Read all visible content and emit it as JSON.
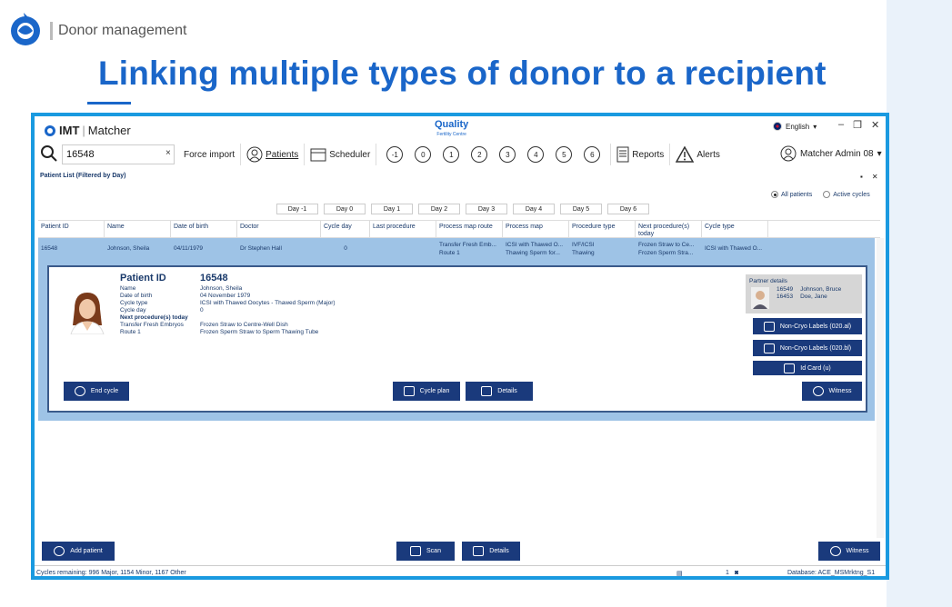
{
  "slide": {
    "section": "Donor management",
    "title": "Linking multiple types of donor to a recipient"
  },
  "app": {
    "brand_bold": "IMT",
    "brand_rest": "Matcher",
    "center_logo": "Quality",
    "center_logo_sub": "Fertility Centre",
    "language": "English",
    "search_value": "16548",
    "toolbar": {
      "force_import": "Force import",
      "patients": "Patients",
      "scheduler": "Scheduler",
      "day_circles": [
        "-1",
        "0",
        "1",
        "2",
        "3",
        "4",
        "5",
        "6"
      ],
      "reports": "Reports",
      "alerts": "Alerts"
    },
    "user": "Matcher Admin 08",
    "panel_title": "Patient List (Filtered by Day)",
    "radios": {
      "all": "All patients",
      "active": "Active cycles"
    },
    "day_tabs": [
      "Day -1",
      "Day 0",
      "Day 1",
      "Day 2",
      "Day 3",
      "Day 4",
      "Day 5",
      "Day 6"
    ],
    "columns": [
      "Patient ID",
      "Name",
      "Date of birth",
      "Doctor",
      "Cycle day",
      "Last procedure",
      "Process map route",
      "Process map",
      "Procedure type",
      "Next procedure(s) today",
      "Cycle type"
    ],
    "row": {
      "patient_id": "16548",
      "name": "Johnson, Sheila",
      "dob": "04/11/1979",
      "doctor": "Dr Stephen Hall",
      "cycle_day": "0",
      "last_procedure": "",
      "route_1": "Transfer Fresh Emb...",
      "route_2": "Route 1",
      "map_1": "ICSI with Thawed O...",
      "map_2": "Thawing Sperm for...",
      "type_1": "IVF/ICSI",
      "type_2": "Thawing",
      "next_1": "Frozen Straw to Ce...",
      "next_2": "Frozen Sperm Stra...",
      "cycle_type": "ICSI with Thawed O..."
    },
    "detail": {
      "pid_label": "Patient ID",
      "pid_value": "16548",
      "fields": [
        {
          "k": "Name",
          "v": "Johnson, Sheila"
        },
        {
          "k": "Date of birth",
          "v": "04 November 1979"
        },
        {
          "k": "Cycle type",
          "v": "ICSI with Thawed Oocytes - Thawed Sperm (Major)"
        },
        {
          "k": "Cycle day",
          "v": "0"
        }
      ],
      "next_heading": "Next procedure(s) today",
      "next_items": [
        {
          "k": "Transfer Fresh Embryos",
          "v": "Frozen Straw to Centre-Well Dish"
        },
        {
          "k": "Route 1",
          "v": "Frozen Sperm Straw to Sperm Thawing Tube"
        }
      ],
      "partner_title": "Partner details",
      "partners": [
        {
          "id": "16549",
          "name": "Johnson, Bruce"
        },
        {
          "id": "16453",
          "name": "Doe, Jane"
        }
      ],
      "buttons": {
        "label_a": "Non-Cryo Labels (020.al)",
        "label_b": "Non-Cryo Labels (020.bl)",
        "id_card": "Id Card (u)",
        "end_cycle": "End cycle",
        "cycle_plan": "Cycle plan",
        "details": "Details",
        "witness": "Witness"
      }
    },
    "bottom": {
      "add_patient": "Add patient",
      "scan": "Scan",
      "details": "Details",
      "witness": "Witness"
    },
    "status": {
      "cycles": "Cycles remaining: 996 Major, 1154 Minor, 1167 Other",
      "count": "1",
      "database": "Database: ACE_MSMrktng_S1"
    }
  }
}
